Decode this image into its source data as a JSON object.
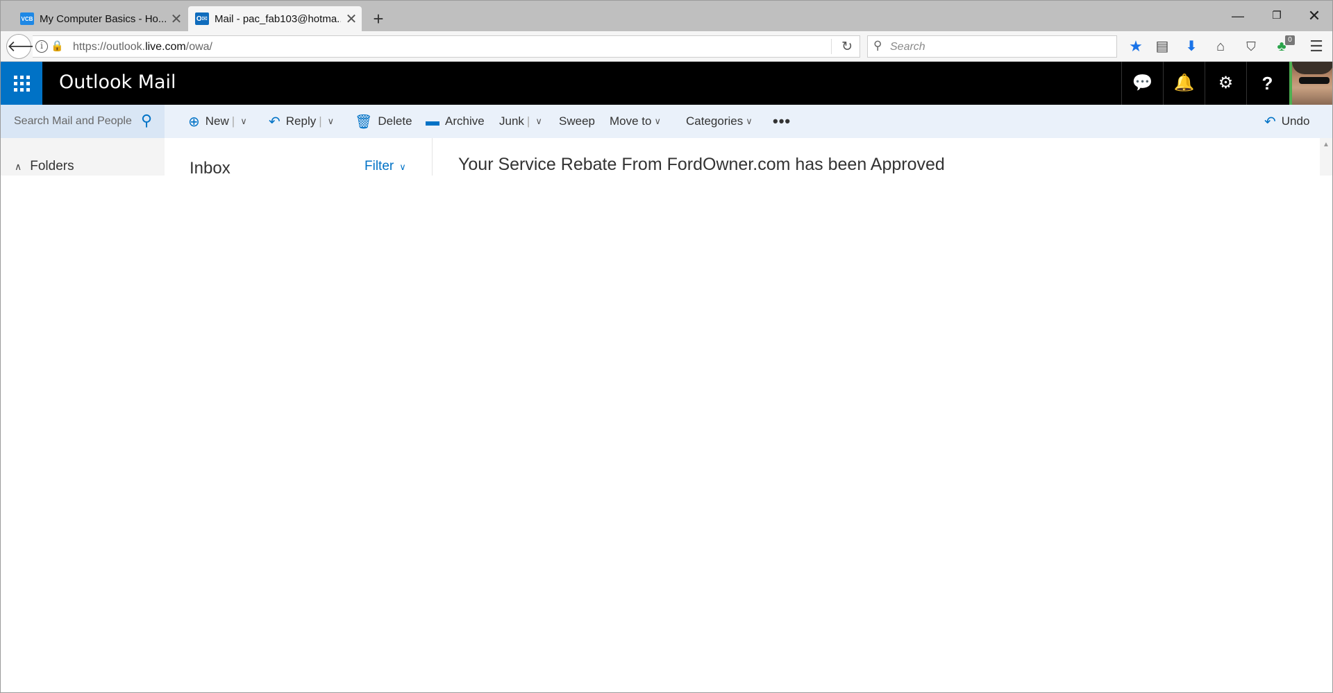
{
  "browser": {
    "tabs": [
      {
        "favicon": "VCB",
        "title": "My Computer Basics - Ho...",
        "close": "✕"
      },
      {
        "favicon": "O✉",
        "title": "Mail - pac_fab103@hotma...",
        "close": "✕"
      }
    ],
    "new_tab": "+",
    "window": {
      "minimize": "—",
      "restore": "❐",
      "close": "✕"
    },
    "back": "🡐",
    "url_prefix": "https://outlook.",
    "url_domain": "live.com",
    "url_suffix": "/owa/",
    "search_placeholder": "Search",
    "extension_badge": "0"
  },
  "outlook": {
    "app_title": "Outlook Mail",
    "header_icons": [
      "chat-icon",
      "bell-icon",
      "gear-icon",
      "help-icon"
    ],
    "help_label": "?",
    "search_placeholder": "Search Mail and People",
    "commands": {
      "new": "New",
      "reply": "Reply",
      "delete": "Delete",
      "archive": "Archive",
      "junk": "Junk",
      "sweep": "Sweep",
      "move_to": "Move to",
      "categories": "Categories",
      "more": "•••",
      "undo": "Undo"
    },
    "folders_label": "Folders",
    "inbox_label": "Inbox",
    "filter_label": "Filter",
    "message_subject": "Your Service Rebate From FordOwner.com has been Approved"
  },
  "colors": {
    "accent": "#0072c6",
    "header_bg": "#000000",
    "command_bar_bg": "#eaf1fa"
  }
}
